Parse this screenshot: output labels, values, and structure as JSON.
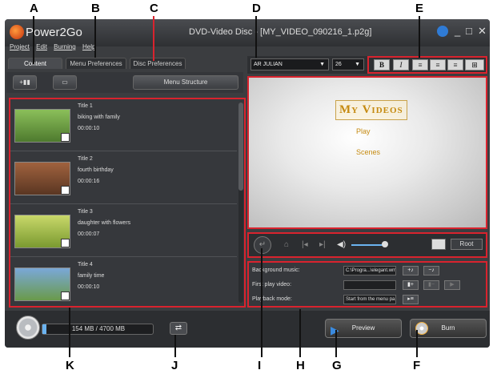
{
  "callouts": {
    "A": "A",
    "B": "B",
    "C": "C",
    "D": "D",
    "E": "E",
    "F": "F",
    "G": "G",
    "H": "H",
    "I": "I",
    "J": "J",
    "K": "K"
  },
  "app": {
    "name": "Power2Go",
    "window_title": "DVD-Video Disc - [MY_VIDEO_090216_1.p2g]"
  },
  "menu": {
    "project": "Project",
    "edit": "Edit",
    "burning": "Burning",
    "help": "Help"
  },
  "tabs": {
    "content": "Content",
    "menu_preferences": "Menu Preferences",
    "disc_preferences": "Disc Preferences"
  },
  "toolbar": {
    "menu_structure": "Menu Structure"
  },
  "titles": [
    {
      "title": "Title 1",
      "desc": "biking with family",
      "duration": "00:00:10"
    },
    {
      "title": "Title 2",
      "desc": "fourth birthday",
      "duration": "00:00:16"
    },
    {
      "title": "Title 3",
      "desc": "daughter with flowers",
      "duration": "00:00:07"
    },
    {
      "title": "Title 4",
      "desc": "family time",
      "duration": "00:00:10"
    }
  ],
  "capacity": {
    "text": "154 MB / 4700 MB",
    "used_fraction": 0.033
  },
  "buttons": {
    "preview": "Preview",
    "burn": "Burn"
  },
  "font": {
    "family": "AR JULIAN",
    "size": "26"
  },
  "format": {
    "bold": "B",
    "italic": "I"
  },
  "menu_preview": {
    "title": "My Videos",
    "play": "Play",
    "scenes": "Scenes"
  },
  "player": {
    "root": "Root"
  },
  "properties": {
    "background_music_label": "Background music:",
    "background_music_value": "C:\\Progra...\\elegant.wma",
    "first_play_label": "First play video:",
    "first_play_value": "",
    "playback_mode_label": "Playback mode:",
    "playback_mode_value": "Start from the menu pa..."
  },
  "colors": {
    "accent_red": "#d9232e",
    "title_gold": "#c58a10"
  }
}
